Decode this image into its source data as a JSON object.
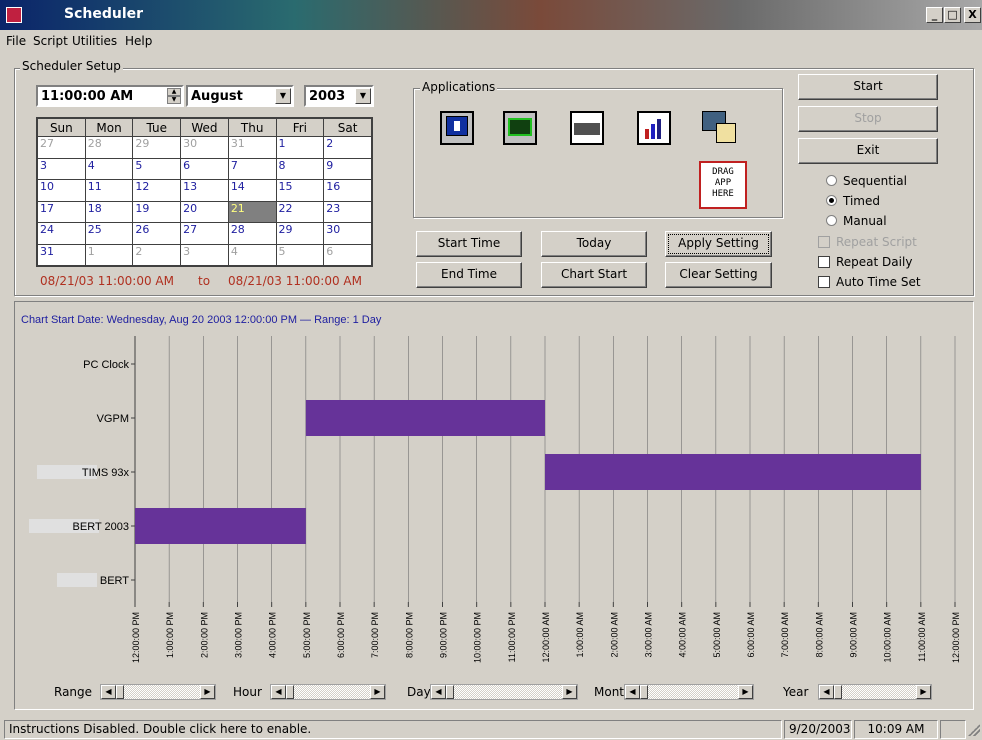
{
  "window": {
    "title": "Scheduler",
    "min": "_",
    "max": "□",
    "close": "X"
  },
  "menu": [
    "File",
    "Script",
    "Utilities",
    "Help"
  ],
  "setup": {
    "group_label": "Scheduler Setup",
    "time": "11:00:00 AM",
    "month": "August",
    "year": "2003",
    "days_header": [
      "Sun",
      "Mon",
      "Tue",
      "Wed",
      "Thu",
      "Fri",
      "Sat"
    ],
    "weeks": [
      [
        "27",
        "28",
        "29",
        "30",
        "31",
        "1",
        "2"
      ],
      [
        "3",
        "4",
        "5",
        "6",
        "7",
        "8",
        "9"
      ],
      [
        "10",
        "11",
        "12",
        "13",
        "14",
        "15",
        "16"
      ],
      [
        "17",
        "18",
        "19",
        "20",
        "21",
        "22",
        "23"
      ],
      [
        "24",
        "25",
        "26",
        "27",
        "28",
        "29",
        "30"
      ],
      [
        "31",
        "1",
        "2",
        "3",
        "4",
        "5",
        "6"
      ]
    ],
    "range_start": "08/21/03  11:00:00 AM",
    "range_to": "to",
    "range_end": "08/21/03  11:00:00 AM"
  },
  "applications": {
    "label": "Applications",
    "drag_lines": [
      "DRAG",
      "APP",
      "HERE"
    ]
  },
  "buttons": {
    "start_time": "Start Time",
    "today": "Today",
    "apply_setting": "Apply Setting",
    "end_time": "End Time",
    "chart_start": "Chart Start",
    "clear_setting": "Clear Setting",
    "start": "Start",
    "stop": "Stop",
    "exit": "Exit"
  },
  "modes": {
    "sequential": "Sequential",
    "timed": "Timed",
    "manual": "Manual",
    "selected": "timed"
  },
  "options": {
    "repeat_script": "Repeat Script",
    "repeat_daily": "Repeat Daily",
    "auto_time_set": "Auto Time Set"
  },
  "chart_data": {
    "type": "gantt",
    "title": "Chart Start Date: Wednesday, Aug 20 2003  12:00:00 PM — Range: 1 Day",
    "rows": [
      "PC Clock",
      "VGPM",
      "TIMS 93x",
      "BERT 2003",
      "BERT"
    ],
    "x_ticks": [
      "12:00:00 PM",
      "1:00:00 PM",
      "2:00:00 PM",
      "3:00:00 PM",
      "4:00:00 PM",
      "5:00:00 PM",
      "6:00:00 PM",
      "7:00:00 PM",
      "8:00:00 PM",
      "9:00:00 PM",
      "10:00:00 PM",
      "11:00:00 PM",
      "12:00:00 AM",
      "1:00:00 AM",
      "2:00:00 AM",
      "3:00:00 AM",
      "4:00:00 AM",
      "5:00:00 AM",
      "6:00:00 AM",
      "7:00:00 AM",
      "8:00:00 AM",
      "9:00:00 AM",
      "10:00:00 AM",
      "11:00:00 AM",
      "12:00:00 PM"
    ],
    "bars": [
      {
        "row": "VGPM",
        "start": "5:00:00 PM",
        "end": "12:00:00 AM",
        "start_h": 5,
        "end_h": 12
      },
      {
        "row": "TIMS 93x",
        "start": "12:00:00 AM",
        "end": "11:00:00 AM",
        "start_h": 12,
        "end_h": 23
      },
      {
        "row": "BERT 2003",
        "start": "12:00:00 PM",
        "end": "5:00:00 PM",
        "start_h": 0,
        "end_h": 5
      }
    ],
    "bar_color": "#663399",
    "title_color": "#2020a0",
    "grid": true
  },
  "scrollers": {
    "range": "Range",
    "hour": "Hour",
    "day": "Day",
    "month": "Month",
    "year": "Year"
  },
  "status": {
    "message": "Instructions Disabled. Double click here to enable.",
    "date": "9/20/2003",
    "time": "10:09 AM"
  }
}
